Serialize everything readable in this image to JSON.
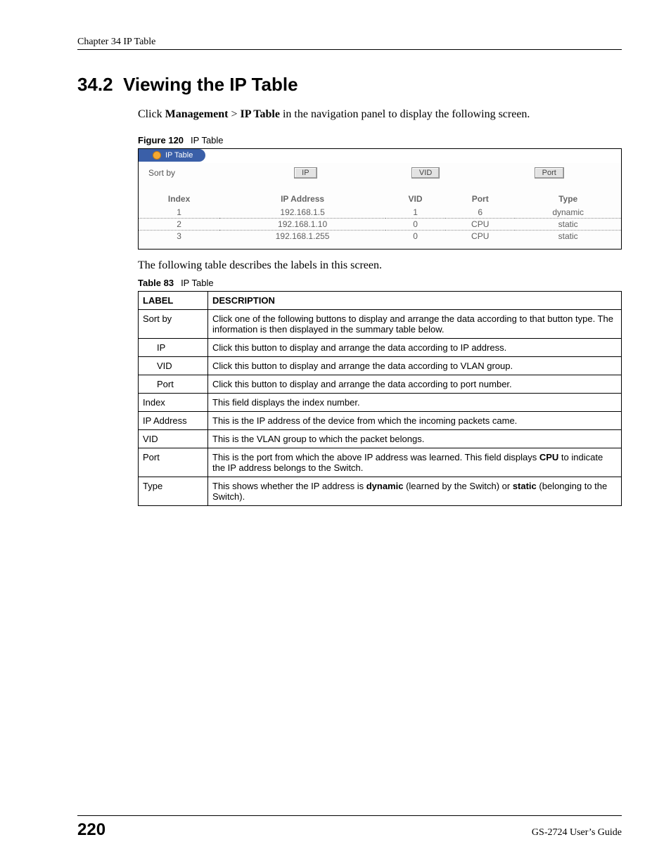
{
  "header": {
    "chapter": "Chapter 34 IP Table"
  },
  "section": {
    "number": "34.2",
    "title": "Viewing the IP Table",
    "intro_pre": "Click ",
    "intro_b1": "Management",
    "intro_gt": " > ",
    "intro_b2": "IP Table",
    "intro_post": " in the navigation panel to display the following screen."
  },
  "figure": {
    "caption_strong": "Figure 120",
    "caption_name": "IP Table",
    "tab_title": "IP Table",
    "sort_label": "Sort by",
    "buttons": {
      "ip": "IP",
      "vid": "VID",
      "port": "Port"
    },
    "columns": [
      "Index",
      "IP Address",
      "VID",
      "Port",
      "Type"
    ],
    "rows": [
      {
        "index": "1",
        "ip": "192.168.1.5",
        "vid": "1",
        "port": "6",
        "type": "dynamic"
      },
      {
        "index": "2",
        "ip": "192.168.1.10",
        "vid": "0",
        "port": "CPU",
        "type": "static"
      },
      {
        "index": "3",
        "ip": "192.168.1.255",
        "vid": "0",
        "port": "CPU",
        "type": "static"
      }
    ]
  },
  "desc_intro": "The following table describes the labels in this screen.",
  "table_caption": {
    "strong": "Table 83",
    "name": "IP Table"
  },
  "desc_table": {
    "head": {
      "label": "LABEL",
      "description": "DESCRIPTION"
    },
    "rows": [
      {
        "label": "Sort by",
        "sub": false,
        "desc": "Click one of the following buttons to display and arrange the data according to that button type. The information is then displayed in the summary table below."
      },
      {
        "label": "IP",
        "sub": true,
        "desc": "Click this button to display and arrange the data according to IP address."
      },
      {
        "label": "VID",
        "sub": true,
        "desc": "Click this button to display and arrange the data according to VLAN group."
      },
      {
        "label": "Port",
        "sub": true,
        "desc": "Click this button to display and arrange the data according to port number."
      },
      {
        "label": "Index",
        "sub": false,
        "desc": "This field displays the index number."
      },
      {
        "label": "IP Address",
        "sub": false,
        "desc": "This is the IP address of the device from which the incoming packets came."
      },
      {
        "label": "VID",
        "sub": false,
        "desc": "This is the VLAN group to which the packet belongs."
      },
      {
        "label": "Port",
        "sub": false,
        "desc_pre": "This is the port from which the above IP address was learned. This field displays ",
        "desc_b1": "CPU",
        "desc_post": " to indicate the IP address belongs to the Switch."
      },
      {
        "label": "Type",
        "sub": false,
        "desc_pre": "This shows whether the IP address is ",
        "desc_b1": "dynamic",
        "desc_mid": " (learned by the Switch) or ",
        "desc_b2": "static",
        "desc_post": " (belonging to the Switch)."
      }
    ]
  },
  "footer": {
    "page": "220",
    "guide": "GS-2724 User’s Guide"
  }
}
